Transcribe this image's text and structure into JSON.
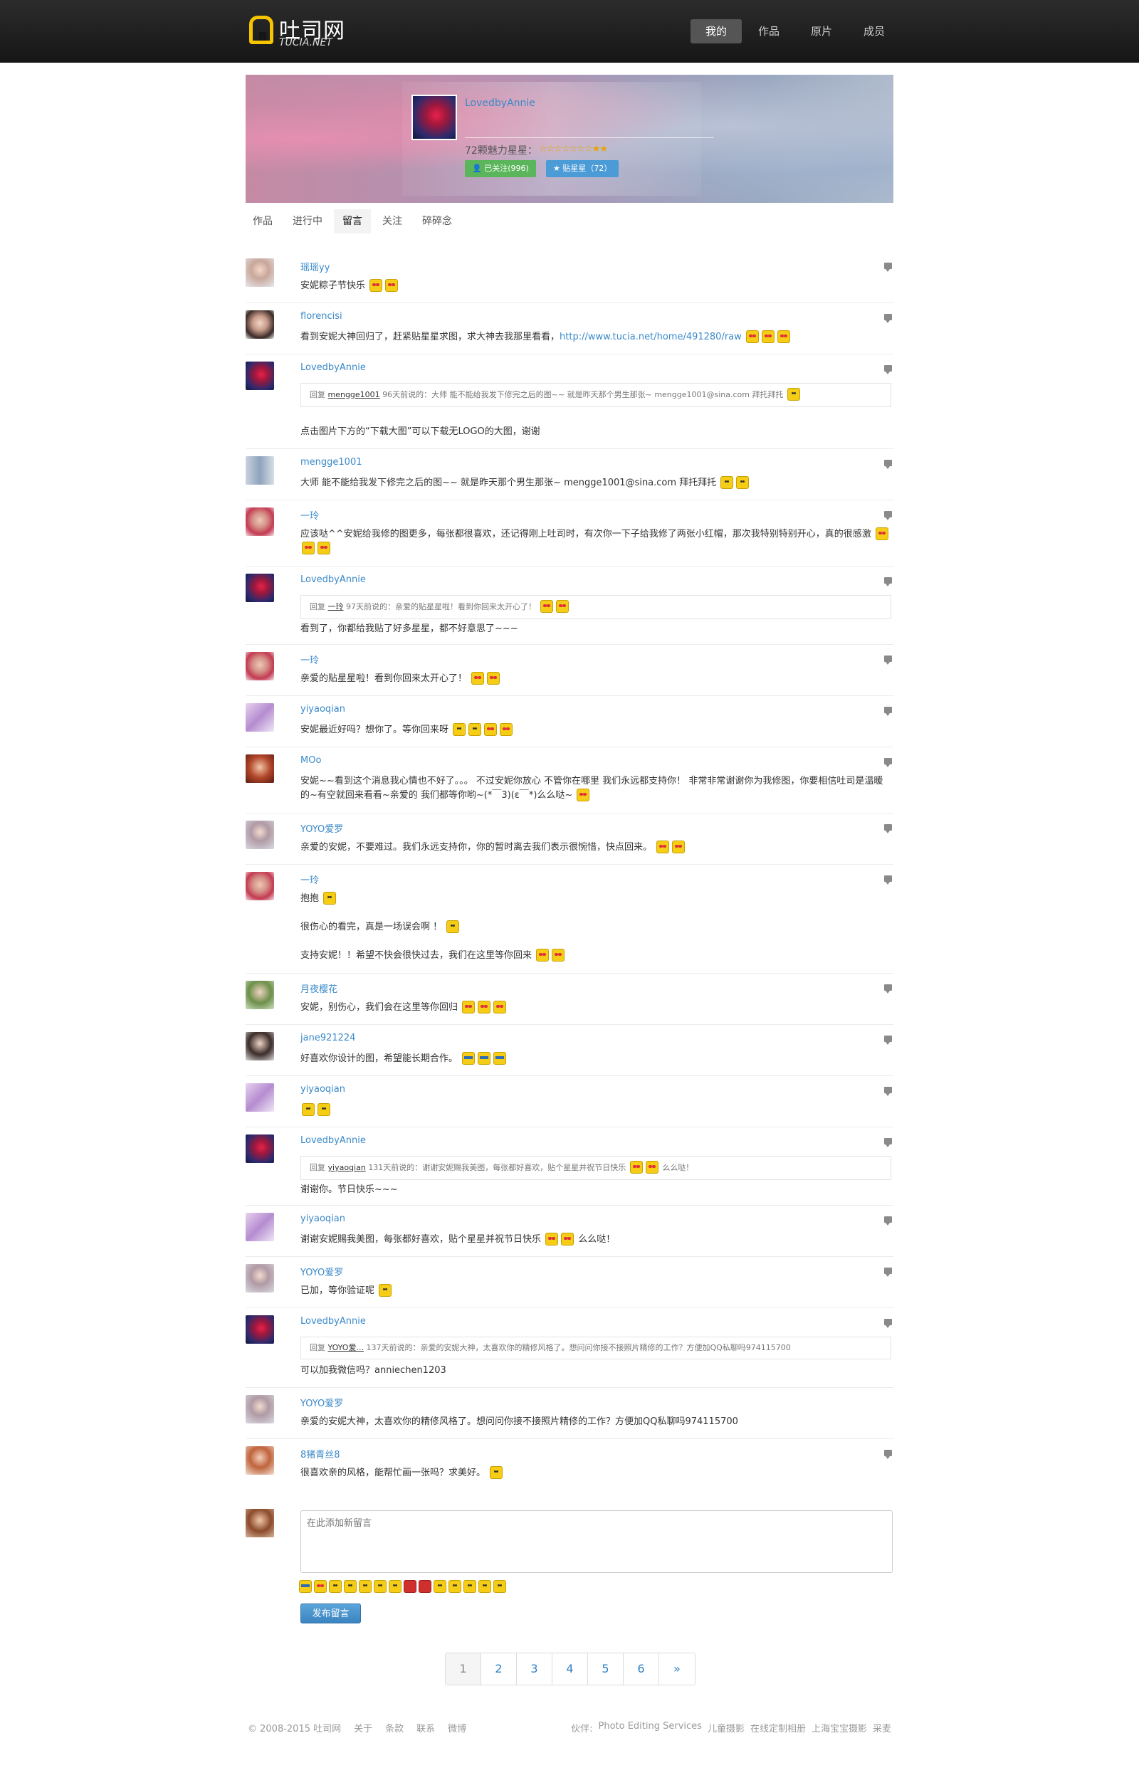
{
  "header": {
    "logo_text": "吐司网",
    "logo_sub": "TUCIA.NET",
    "nav": [
      "我的",
      "作品",
      "原片",
      "成员"
    ]
  },
  "profile": {
    "name": "LovedbyAnnie",
    "stars_label": "72颗魅力星星：",
    "stars_glyphs": "☆☆☆☆☆☆☆★★",
    "follow_button": "已关注(996)",
    "star_button": "贴星星（72）"
  },
  "tabs": [
    "作品",
    "进行中",
    "留言",
    "关注",
    "碎碎念"
  ],
  "comments": [
    {
      "author": "瑶瑶yy",
      "text": "安妮粽子节快乐"
    },
    {
      "author": "florencisi",
      "text": "看到安妮大神回归了，赶紧贴星星求图，求大神去我那里看看，",
      "link": "http://www.tucia.net/home/491280/raw"
    },
    {
      "author": "LovedbyAnnie",
      "quote_prefix": "回复",
      "quote_user": "mengge1001",
      "quote_text": "96天前说的：大师 能不能给我发下修完之后的图~~ 就是昨天那个男生那张~ mengge1001@sina.com 拜托拜托",
      "text": "点击图片下方的“下载大图”可以下载无LOGO的大图，谢谢"
    },
    {
      "author": "mengge1001",
      "text": "大师 能不能给我发下修完之后的图~~ 就是昨天那个男生那张~ mengge1001@sina.com 拜托拜托"
    },
    {
      "author": "一玲",
      "text": "应该哒^^安妮给我修的图更多，每张都很喜欢，还记得刚上吐司时，有次你一下子给我修了两张小红帽，那次我特别特别开心，真的很感激"
    },
    {
      "author": "LovedbyAnnie",
      "quote_prefix": "回复",
      "quote_user": "一玲",
      "quote_text": "97天前说的：亲爱的贴星星啦！看到你回来太开心了！",
      "text": "看到了，你都给我贴了好多星星，都不好意思了~~~"
    },
    {
      "author": "一玲",
      "text": "亲爱的贴星星啦！看到你回来太开心了！"
    },
    {
      "author": "yiyaoqian",
      "text": "安妮最近好吗？想你了。等你回来呀"
    },
    {
      "author": "MOo",
      "text": "安妮~~看到这个消息我心情也不好了。。。 不过安妮你放心 不管你在哪里 我们永远都支持你！ 非常非常谢谢你为我修图，你要相信吐司是温暖的~有空就回来看看~亲爱的 我们都等你哟~(*￣3)(ε￣*)么么哒~"
    },
    {
      "author": "YOYO爱罗",
      "text": "亲爱的安妮，不要难过。我们永远支持你，你的暂时离去我们表示很惋惜，快点回来。"
    },
    {
      "author": "一玲",
      "text": "抱抱",
      "text2": "很伤心的看完，真是一场误会啊 ！",
      "text3": "支持安妮！！希望不快会很快过去，我们在这里等你回来"
    },
    {
      "author": "月夜樱花",
      "text": "安妮，别伤心，我们会在这里等你回归"
    },
    {
      "author": "jane921224",
      "text": "好喜欢你设计的图，希望能长期合作。"
    },
    {
      "author": "yiyaoqian",
      "text": ""
    },
    {
      "author": "LovedbyAnnie",
      "quote_prefix": "回复",
      "quote_user": "yiyaoqian",
      "quote_text": "131天前说的：谢谢安妮赐我美图，每张都好喜欢，贴个星星并祝节日快乐",
      "quote_tail": "么么哒！",
      "text": "谢谢你。节日快乐~~~"
    },
    {
      "author": "yiyaoqian",
      "text": "谢谢安妮赐我美图，每张都好喜欢，贴个星星并祝节日快乐",
      "tail": "么么哒！"
    },
    {
      "author": "YOYO爱罗",
      "text": "已加，等你验证呢"
    },
    {
      "author": "LovedbyAnnie",
      "quote_prefix": "回复",
      "quote_user": "YOYO爱...",
      "quote_text": "137天前说的：亲爱的安妮大神，太喜欢你的精修风格了。想问问你接不接照片精修的工作？方便加QQ私聊吗974115700",
      "text": "可以加我微信吗？anniechen1203"
    },
    {
      "author": "YOYO爱罗",
      "text": "亲爱的安妮大神，太喜欢你的精修风格了。想问问你接不接照片精修的工作？方便加QQ私聊吗974115700"
    },
    {
      "author": "8猪青丝8",
      "text": "很喜欢亲的风格，能帮忙画一张吗？求美好。"
    }
  ],
  "compose": {
    "placeholder": "在此添加新留言",
    "submit": "发布留言"
  },
  "pagination": [
    "1",
    "2",
    "3",
    "4",
    "5",
    "6",
    "»"
  ],
  "footer": {
    "left": [
      "© 2008-2015 吐司网",
      "关于",
      "条款",
      "联系",
      "微博"
    ],
    "right": [
      "伙伴:",
      "Photo Editing Services",
      "儿童摄影",
      "在线定制相册",
      "上海宝宝摄影",
      "采麦"
    ]
  }
}
